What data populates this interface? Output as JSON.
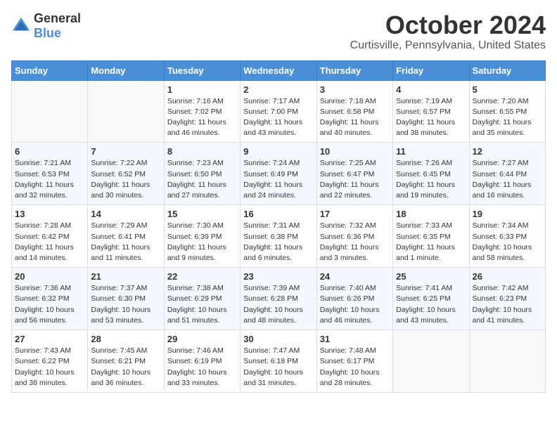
{
  "header": {
    "logo_general": "General",
    "logo_blue": "Blue",
    "month_title": "October 2024",
    "location": "Curtisville, Pennsylvania, United States"
  },
  "weekdays": [
    "Sunday",
    "Monday",
    "Tuesday",
    "Wednesday",
    "Thursday",
    "Friday",
    "Saturday"
  ],
  "weeks": [
    [
      {
        "day": "",
        "sunrise": "",
        "sunset": "",
        "daylight": ""
      },
      {
        "day": "",
        "sunrise": "",
        "sunset": "",
        "daylight": ""
      },
      {
        "day": "1",
        "sunrise": "Sunrise: 7:16 AM",
        "sunset": "Sunset: 7:02 PM",
        "daylight": "Daylight: 11 hours and 46 minutes."
      },
      {
        "day": "2",
        "sunrise": "Sunrise: 7:17 AM",
        "sunset": "Sunset: 7:00 PM",
        "daylight": "Daylight: 11 hours and 43 minutes."
      },
      {
        "day": "3",
        "sunrise": "Sunrise: 7:18 AM",
        "sunset": "Sunset: 6:58 PM",
        "daylight": "Daylight: 11 hours and 40 minutes."
      },
      {
        "day": "4",
        "sunrise": "Sunrise: 7:19 AM",
        "sunset": "Sunset: 6:57 PM",
        "daylight": "Daylight: 11 hours and 38 minutes."
      },
      {
        "day": "5",
        "sunrise": "Sunrise: 7:20 AM",
        "sunset": "Sunset: 6:55 PM",
        "daylight": "Daylight: 11 hours and 35 minutes."
      }
    ],
    [
      {
        "day": "6",
        "sunrise": "Sunrise: 7:21 AM",
        "sunset": "Sunset: 6:53 PM",
        "daylight": "Daylight: 11 hours and 32 minutes."
      },
      {
        "day": "7",
        "sunrise": "Sunrise: 7:22 AM",
        "sunset": "Sunset: 6:52 PM",
        "daylight": "Daylight: 11 hours and 30 minutes."
      },
      {
        "day": "8",
        "sunrise": "Sunrise: 7:23 AM",
        "sunset": "Sunset: 6:50 PM",
        "daylight": "Daylight: 11 hours and 27 minutes."
      },
      {
        "day": "9",
        "sunrise": "Sunrise: 7:24 AM",
        "sunset": "Sunset: 6:49 PM",
        "daylight": "Daylight: 11 hours and 24 minutes."
      },
      {
        "day": "10",
        "sunrise": "Sunrise: 7:25 AM",
        "sunset": "Sunset: 6:47 PM",
        "daylight": "Daylight: 11 hours and 22 minutes."
      },
      {
        "day": "11",
        "sunrise": "Sunrise: 7:26 AM",
        "sunset": "Sunset: 6:45 PM",
        "daylight": "Daylight: 11 hours and 19 minutes."
      },
      {
        "day": "12",
        "sunrise": "Sunrise: 7:27 AM",
        "sunset": "Sunset: 6:44 PM",
        "daylight": "Daylight: 11 hours and 16 minutes."
      }
    ],
    [
      {
        "day": "13",
        "sunrise": "Sunrise: 7:28 AM",
        "sunset": "Sunset: 6:42 PM",
        "daylight": "Daylight: 11 hours and 14 minutes."
      },
      {
        "day": "14",
        "sunrise": "Sunrise: 7:29 AM",
        "sunset": "Sunset: 6:41 PM",
        "daylight": "Daylight: 11 hours and 11 minutes."
      },
      {
        "day": "15",
        "sunrise": "Sunrise: 7:30 AM",
        "sunset": "Sunset: 6:39 PM",
        "daylight": "Daylight: 11 hours and 9 minutes."
      },
      {
        "day": "16",
        "sunrise": "Sunrise: 7:31 AM",
        "sunset": "Sunset: 6:38 PM",
        "daylight": "Daylight: 11 hours and 6 minutes."
      },
      {
        "day": "17",
        "sunrise": "Sunrise: 7:32 AM",
        "sunset": "Sunset: 6:36 PM",
        "daylight": "Daylight: 11 hours and 3 minutes."
      },
      {
        "day": "18",
        "sunrise": "Sunrise: 7:33 AM",
        "sunset": "Sunset: 6:35 PM",
        "daylight": "Daylight: 11 hours and 1 minute."
      },
      {
        "day": "19",
        "sunrise": "Sunrise: 7:34 AM",
        "sunset": "Sunset: 6:33 PM",
        "daylight": "Daylight: 10 hours and 58 minutes."
      }
    ],
    [
      {
        "day": "20",
        "sunrise": "Sunrise: 7:36 AM",
        "sunset": "Sunset: 6:32 PM",
        "daylight": "Daylight: 10 hours and 56 minutes."
      },
      {
        "day": "21",
        "sunrise": "Sunrise: 7:37 AM",
        "sunset": "Sunset: 6:30 PM",
        "daylight": "Daylight: 10 hours and 53 minutes."
      },
      {
        "day": "22",
        "sunrise": "Sunrise: 7:38 AM",
        "sunset": "Sunset: 6:29 PM",
        "daylight": "Daylight: 10 hours and 51 minutes."
      },
      {
        "day": "23",
        "sunrise": "Sunrise: 7:39 AM",
        "sunset": "Sunset: 6:28 PM",
        "daylight": "Daylight: 10 hours and 48 minutes."
      },
      {
        "day": "24",
        "sunrise": "Sunrise: 7:40 AM",
        "sunset": "Sunset: 6:26 PM",
        "daylight": "Daylight: 10 hours and 46 minutes."
      },
      {
        "day": "25",
        "sunrise": "Sunrise: 7:41 AM",
        "sunset": "Sunset: 6:25 PM",
        "daylight": "Daylight: 10 hours and 43 minutes."
      },
      {
        "day": "26",
        "sunrise": "Sunrise: 7:42 AM",
        "sunset": "Sunset: 6:23 PM",
        "daylight": "Daylight: 10 hours and 41 minutes."
      }
    ],
    [
      {
        "day": "27",
        "sunrise": "Sunrise: 7:43 AM",
        "sunset": "Sunset: 6:22 PM",
        "daylight": "Daylight: 10 hours and 38 minutes."
      },
      {
        "day": "28",
        "sunrise": "Sunrise: 7:45 AM",
        "sunset": "Sunset: 6:21 PM",
        "daylight": "Daylight: 10 hours and 36 minutes."
      },
      {
        "day": "29",
        "sunrise": "Sunrise: 7:46 AM",
        "sunset": "Sunset: 6:19 PM",
        "daylight": "Daylight: 10 hours and 33 minutes."
      },
      {
        "day": "30",
        "sunrise": "Sunrise: 7:47 AM",
        "sunset": "Sunset: 6:18 PM",
        "daylight": "Daylight: 10 hours and 31 minutes."
      },
      {
        "day": "31",
        "sunrise": "Sunrise: 7:48 AM",
        "sunset": "Sunset: 6:17 PM",
        "daylight": "Daylight: 10 hours and 28 minutes."
      },
      {
        "day": "",
        "sunrise": "",
        "sunset": "",
        "daylight": ""
      },
      {
        "day": "",
        "sunrise": "",
        "sunset": "",
        "daylight": ""
      }
    ]
  ]
}
